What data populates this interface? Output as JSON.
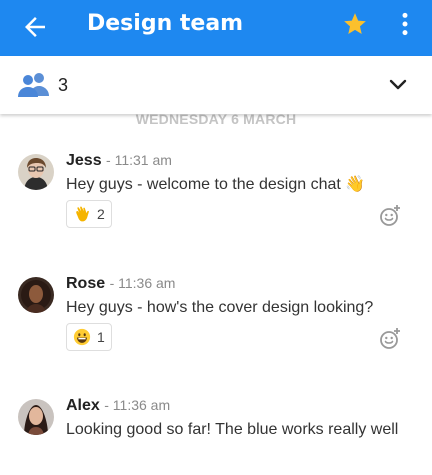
{
  "header": {
    "title": "Design team",
    "icons": [
      "back-arrow-icon",
      "star-icon",
      "more-vert-icon"
    ],
    "color": "#1e88f0",
    "star_color": "#fbc02d"
  },
  "members": {
    "count": "3",
    "icons": [
      "people-icon",
      "chevron-down-icon"
    ]
  },
  "date_separator": "WEDNESDAY 6 MARCH",
  "messages": [
    {
      "author": "Jess",
      "time": "- 11:31 am",
      "text": "Hey guys - welcome to the design chat 👋",
      "reaction": {
        "emoji": "waving-hand-emoji",
        "count": "2"
      }
    },
    {
      "author": "Rose",
      "time": "- 11:36 am",
      "text": "Hey guys - how's the cover design looking?",
      "reaction": {
        "emoji": "grinning-face-emoji",
        "count": "1"
      }
    },
    {
      "author": "Alex",
      "time": "- 11:36 am",
      "text": "Looking good so far! The blue works really well"
    }
  ]
}
